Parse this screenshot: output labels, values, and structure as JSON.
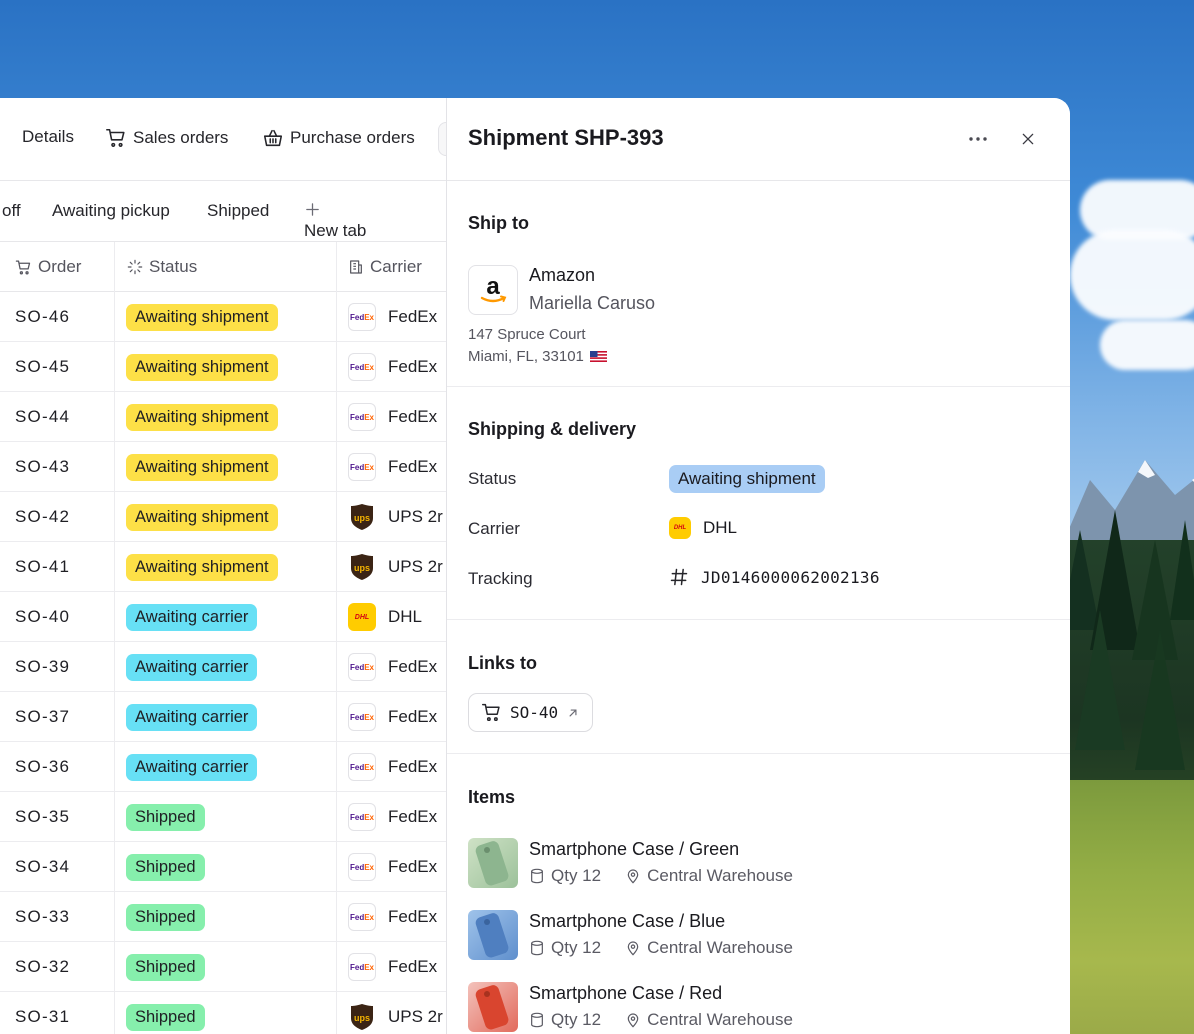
{
  "top_nav": {
    "details": "Details",
    "sales_orders": "Sales orders",
    "purchase_orders": "Purchase orders"
  },
  "sub_tabs": {
    "off_tab": "off",
    "awaiting_pickup": "Awaiting pickup",
    "shipped": "Shipped",
    "new_tab": "New tab"
  },
  "table": {
    "headers": {
      "order": "Order",
      "status": "Status",
      "carrier": "Carrier"
    },
    "rows": [
      {
        "order": "SO-46",
        "status": "Awaiting shipment",
        "carrier": "FedEx"
      },
      {
        "order": "SO-45",
        "status": "Awaiting shipment",
        "carrier": "FedEx"
      },
      {
        "order": "SO-44",
        "status": "Awaiting shipment",
        "carrier": "FedEx"
      },
      {
        "order": "SO-43",
        "status": "Awaiting shipment",
        "carrier": "FedEx"
      },
      {
        "order": "SO-42",
        "status": "Awaiting shipment",
        "carrier": "UPS 2r"
      },
      {
        "order": "SO-41",
        "status": "Awaiting shipment",
        "carrier": "UPS 2r"
      },
      {
        "order": "SO-40",
        "status": "Awaiting carrier",
        "carrier": "DHL"
      },
      {
        "order": "SO-39",
        "status": "Awaiting carrier",
        "carrier": "FedEx"
      },
      {
        "order": "SO-37",
        "status": "Awaiting carrier",
        "carrier": "FedEx"
      },
      {
        "order": "SO-36",
        "status": "Awaiting carrier",
        "carrier": "FedEx"
      },
      {
        "order": "SO-35",
        "status": "Shipped",
        "carrier": "FedEx"
      },
      {
        "order": "SO-34",
        "status": "Shipped",
        "carrier": "FedEx"
      },
      {
        "order": "SO-33",
        "status": "Shipped",
        "carrier": "FedEx"
      },
      {
        "order": "SO-32",
        "status": "Shipped",
        "carrier": "FedEx"
      },
      {
        "order": "SO-31",
        "status": "Shipped",
        "carrier": "UPS 2r"
      }
    ]
  },
  "colors": {
    "awaiting_shipment": "#fde047",
    "awaiting_carrier": "#67e0f5",
    "shipped": "#86efac",
    "status_pill_blue": "#a9cdf5"
  },
  "logo_text": {
    "fedex_a": "Fed",
    "fedex_b": "Ex",
    "ups": "ups",
    "dhl": "DHL",
    "amazon": "a"
  },
  "detail": {
    "title": "Shipment SHP-393",
    "ship_to": {
      "section": "Ship to",
      "company": "Amazon",
      "contact": "Mariella Caruso",
      "address1": "147 Spruce Court",
      "address2": "Miami, FL, 33101"
    },
    "shipping": {
      "section": "Shipping & delivery",
      "status_label": "Status",
      "status_value": "Awaiting shipment",
      "carrier_label": "Carrier",
      "carrier_value": "DHL",
      "tracking_label": "Tracking",
      "tracking_value": "JD0146000062002136"
    },
    "links": {
      "section": "Links to",
      "chip": "SO-40"
    },
    "items": {
      "section": "Items",
      "list": [
        {
          "name": "Smartphone Case / Green",
          "qty": "Qty 12",
          "location": "Central Warehouse"
        },
        {
          "name": "Smartphone Case / Blue",
          "qty": "Qty 12",
          "location": "Central Warehouse"
        },
        {
          "name": "Smartphone Case / Red",
          "qty": "Qty 12",
          "location": "Central Warehouse"
        }
      ]
    }
  }
}
